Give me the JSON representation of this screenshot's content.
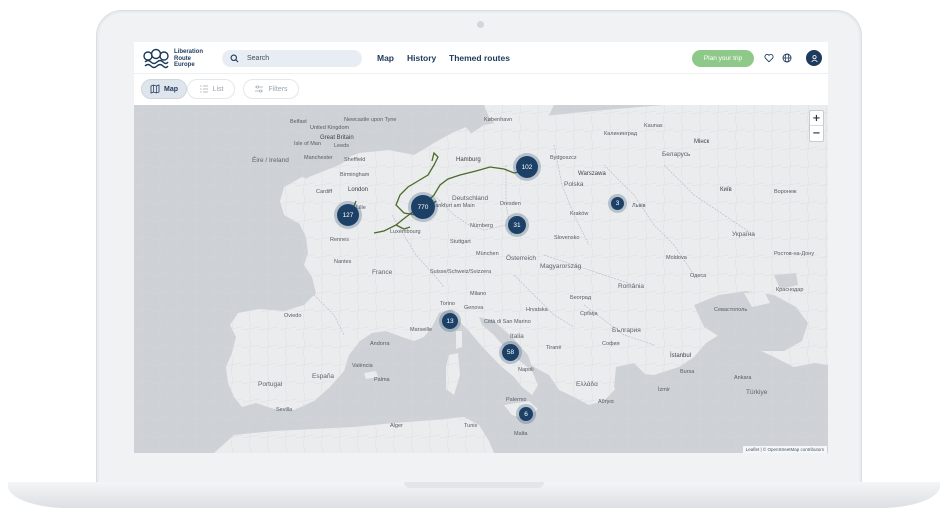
{
  "logo": {
    "lines": [
      "Liberation",
      "Route",
      "Europe"
    ]
  },
  "header": {
    "search_placeholder": "Search",
    "nav": {
      "map": "Map",
      "history": "History",
      "themed_routes": "Themed routes"
    },
    "plan_button": "Plan your trip"
  },
  "view_toggle": {
    "map": "Map",
    "list": "List",
    "filters": "Filters"
  },
  "map": {
    "clusters": [
      {
        "label": "127"
      },
      {
        "label": "770"
      },
      {
        "label": "102"
      },
      {
        "label": "31"
      },
      {
        "label": "3"
      },
      {
        "label": "13"
      },
      {
        "label": "58"
      },
      {
        "label": "6"
      }
    ],
    "places": {
      "ireland": "Éire / Ireland",
      "uk": "United Kingdom",
      "great_britain": "Great Britain",
      "isle_of_man": "Isle of Man",
      "leeds": "Leeds",
      "manchester": "Manchester",
      "sheffield": "Sheffield",
      "birmingham": "Birmingham",
      "london": "London",
      "cardiff": "Cardiff",
      "belfast": "Belfast",
      "newcastle": "Newcastle upon Tyne",
      "kobenhavn": "København",
      "hamburg": "Hamburg",
      "bydgoszcz": "Bydgoszcz",
      "polska": "Polska",
      "warszawa": "Warszawa",
      "deutschland": "Deutschland",
      "frankfurt": "Frankfurt am Main",
      "nurnberg": "Nürnberg",
      "dresden": "Dresden",
      "krakow": "Kraków",
      "luxembourg": "Luxembourg",
      "stuttgart": "Stuttgart",
      "munchen": "München",
      "osterreich": "Österreich",
      "slovensko": "Slovensko",
      "magyarorszag": "Magyarország",
      "france": "France",
      "nantes": "Nantes",
      "rennes": "Rennes",
      "lille": "Lille",
      "schweiz": "Suisse/Schweiz/Svizzera",
      "torino": "Torino",
      "genova": "Genova",
      "milano": "Milano",
      "hrvatska": "Hrvatska",
      "romania": "România",
      "srbija": "Србија",
      "bulgaria": "България",
      "italia": "Italia",
      "citta_marino": "Città di San Marino",
      "marseille": "Marseille",
      "andorra": "Andorra",
      "espana": "España",
      "portugal": "Portugal",
      "sevilla": "Sevilla",
      "oviedo": "Oviedo",
      "palma": "Palma",
      "napoli": "Napoli",
      "palermo": "Palermo",
      "malta": "Malta",
      "tunis": "Tunis",
      "alger": "Alger",
      "ukraina": "Україна",
      "lviv": "Львів",
      "kyiv": "Київ",
      "minsk": "Мінск",
      "belarus": "Беларусь",
      "moldova": "Moldova",
      "odesa": "Одеса",
      "sevastopol": "Севастополь",
      "istanbul": "İstanbul",
      "turkiye": "Türkiye",
      "ankara": "Ankara",
      "athina": "Αθήνα",
      "ellada": "Ελλάδα",
      "izmir": "İzmir",
      "bursa": "Bursa",
      "kaunas": "Kaunas",
      "kaliningrad": "Калининград",
      "krasnodar": "Краснодар",
      "rostov": "Ростов-на-Дону",
      "voronezh": "Воронеж",
      "sofia": "София",
      "beograd": "Београд",
      "tirana": "Tiranë",
      "valencia": "València"
    },
    "zoom_in": "+",
    "zoom_out": "−",
    "attribution": "Leaflet | © OpenStreetMap contributors"
  },
  "colors": {
    "brand_navy": "#1d4166",
    "plan_green": "#8fc98a",
    "route_green": "#4b6b2a"
  }
}
